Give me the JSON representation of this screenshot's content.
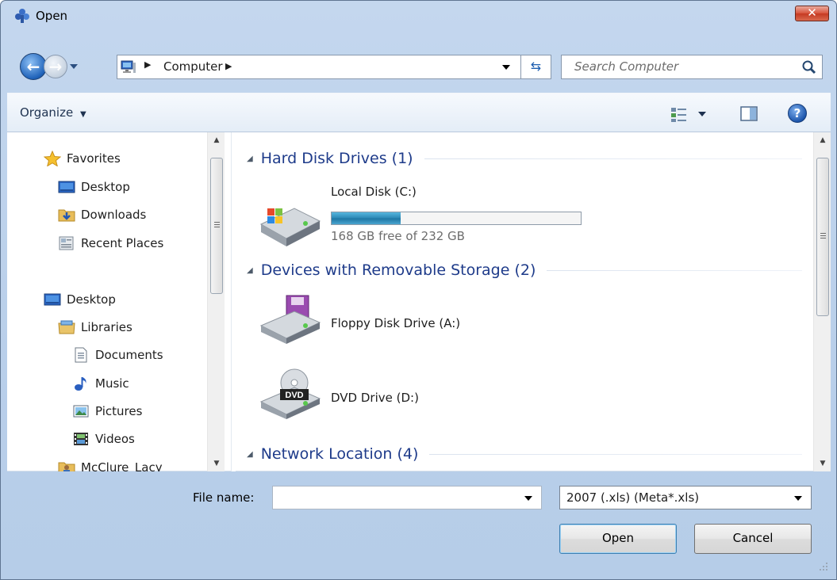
{
  "window": {
    "title": "Open",
    "close_label": "✕"
  },
  "address_bar": {
    "breadcrumb": "Computer",
    "separator": "▶"
  },
  "search": {
    "placeholder": "Search Computer"
  },
  "toolbar": {
    "organize_label": "Organize",
    "organize_arrow": "▼",
    "help_label": "?"
  },
  "nav_pane": {
    "items": [
      {
        "label": "Favorites",
        "icon": "star-icon"
      },
      {
        "label": "Desktop",
        "icon": "desktop-icon"
      },
      {
        "label": "Downloads",
        "icon": "downloads-folder-icon"
      },
      {
        "label": "Recent Places",
        "icon": "recent-places-icon"
      },
      {
        "label": "Desktop",
        "icon": "desktop-icon"
      },
      {
        "label": "Libraries",
        "icon": "libraries-icon"
      },
      {
        "label": "Documents",
        "icon": "document-icon"
      },
      {
        "label": "Music",
        "icon": "music-note-icon"
      },
      {
        "label": "Pictures",
        "icon": "pictures-icon"
      },
      {
        "label": "Videos",
        "icon": "film-icon"
      },
      {
        "label": "McClure_Lacy",
        "icon": "user-folder-icon"
      }
    ]
  },
  "main_pane": {
    "groups": [
      {
        "title": "Hard Disk Drives (1)",
        "items": [
          {
            "name": "Local Disk (C:)",
            "free_text": "168 GB free of 232 GB",
            "used_fraction": 0.276
          }
        ]
      },
      {
        "title": "Devices with Removable Storage (2)",
        "items": [
          {
            "name": "Floppy Disk Drive (A:)"
          },
          {
            "name": "DVD Drive (D:)",
            "badge": "DVD"
          }
        ]
      },
      {
        "title": "Network Location (4)",
        "items": []
      }
    ]
  },
  "bottom": {
    "file_name_label": "File name:",
    "file_name_value": "",
    "file_type_value": "2007 (.xls) (Meta*.xls)",
    "open_label": "Open",
    "cancel_label": "Cancel"
  },
  "colors": {
    "group_title": "#1e3b8a",
    "capacity_fill": "#2a87b5",
    "close_button": "#c53a22"
  }
}
